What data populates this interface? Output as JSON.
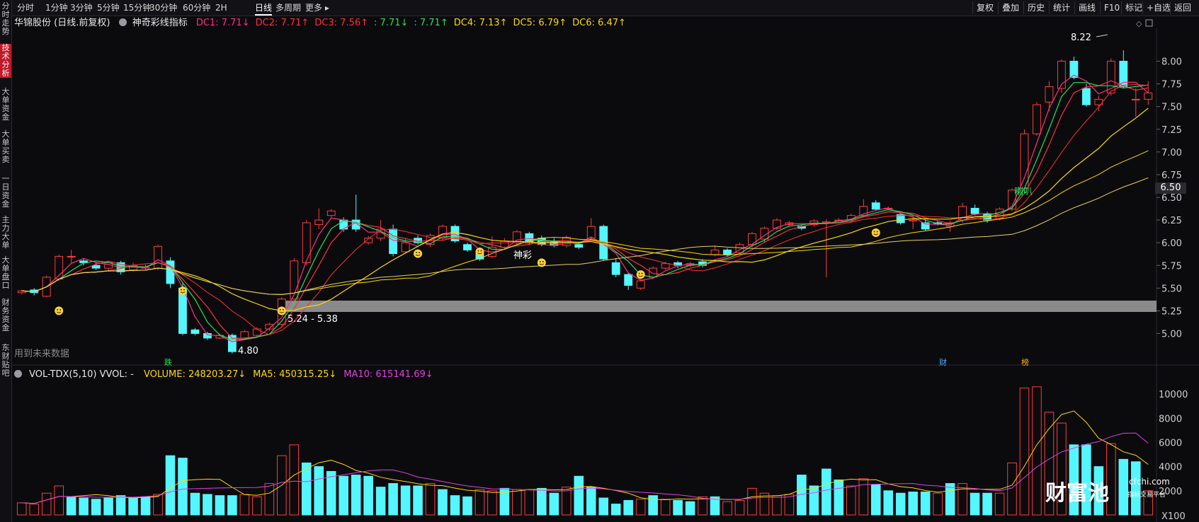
{
  "sidebar": [
    {
      "label": "分时走势",
      "active": false
    },
    {
      "label": "技术分析",
      "active": true
    },
    {
      "label": "大单资金",
      "active": false
    },
    {
      "label": "大单买卖",
      "active": false
    },
    {
      "label": "一日资金",
      "active": false
    },
    {
      "label": "主力大单",
      "active": false
    },
    {
      "label": "大单盘口",
      "active": false
    },
    {
      "label": "财务资金",
      "active": false
    },
    {
      "label": "东财贴吧",
      "active": false
    }
  ],
  "timeframes": [
    "分时",
    "1分钟",
    "3分钟",
    "5分钟",
    "15分钟",
    "30分钟",
    "60分钟",
    "2H",
    "日线",
    "多周期",
    "更多 ▸"
  ],
  "active_timeframe": "日线",
  "tools": [
    "复权",
    "叠加",
    "历史",
    "统计",
    "画线",
    "F10",
    "标记",
    "+自选",
    "返回"
  ],
  "main_header": {
    "stock": "华锦股份 (日线.前复权)",
    "indicator_icon": "gear-icon",
    "indicator": "神奇彩线指标",
    "values": [
      {
        "text": "DC1: 7.71↓",
        "color": "#ff2f7d"
      },
      {
        "text": "DC2: 7.71↑",
        "color": "#ff3040"
      },
      {
        "text": "DC3: 7.56↑",
        "color": "#ff3030"
      },
      {
        "text": ": 7.71↓",
        "color": "#22e05a"
      },
      {
        "text": ": 7.71↑",
        "color": "#22e05a"
      },
      {
        "text": "DC4: 7.13↑",
        "color": "#ffd800"
      },
      {
        "text": "DC5: 6.79↑",
        "color": "#ffd800"
      },
      {
        "text": "DC6: 6.47↑",
        "color": "#ffd800"
      }
    ]
  },
  "volume_header": {
    "icon": "gear-icon",
    "label": "VOL-TDX(5,10) VVOL: -",
    "values": [
      {
        "text": "VOLUME: 248203.27↓",
        "color": "#ffd800"
      },
      {
        "text": "MA5: 450315.25↓",
        "color": "#ffd800"
      },
      {
        "text": "MA10: 615141.69↓",
        "color": "#e040e0"
      }
    ]
  },
  "price_axis": [
    "8.00",
    "7.75",
    "7.50",
    "7.25",
    "7.00",
    "6.75",
    "6.50",
    "6.25",
    "6.00",
    "5.75",
    "5.50",
    "5.25",
    "5.00"
  ],
  "current_price": "6.50",
  "volume_axis": [
    "10000",
    "8000",
    "6000",
    "4000",
    "2000"
  ],
  "volume_unit": "X100",
  "annotations": {
    "high": "8.22",
    "low": "4.80",
    "gap_zone": "5.24 - 5.38",
    "future_data": "用到未来数据",
    "shencai": "神彩",
    "laba": "喇叭",
    "die": "跌",
    "cai": "财",
    "bang": "榜"
  },
  "watermark": {
    "main": "财富池",
    "domain": "cfchi.com",
    "tagline": "指标交易平台"
  },
  "colors": {
    "up": "#ff3b3b",
    "down": "#54f6ff",
    "bg": "#0b0b0e"
  },
  "chart_data": {
    "type": "candlestick",
    "price_range": [
      4.7,
      8.3
    ],
    "candles": [
      [
        5.45,
        5.47,
        5.43,
        5.48
      ],
      [
        5.48,
        5.45,
        5.42,
        5.5
      ],
      [
        5.41,
        5.62,
        5.4,
        5.64
      ],
      [
        5.6,
        5.85,
        5.58,
        5.87
      ],
      [
        5.85,
        5.85,
        5.78,
        5.92
      ],
      [
        5.8,
        5.78,
        5.75,
        5.82
      ],
      [
        5.75,
        5.72,
        5.7,
        5.78
      ],
      [
        5.72,
        5.78,
        5.68,
        5.8
      ],
      [
        5.78,
        5.68,
        5.65,
        5.8
      ],
      [
        5.7,
        5.75,
        5.68,
        5.78
      ],
      [
        5.72,
        5.73,
        5.7,
        5.76
      ],
      [
        5.72,
        5.96,
        5.7,
        5.98
      ],
      [
        5.8,
        5.55,
        5.5,
        5.84
      ],
      [
        5.5,
        5.0,
        4.98,
        5.55
      ],
      [
        5.04,
        5.0,
        4.98,
        5.06
      ],
      [
        5.0,
        4.95,
        4.93,
        5.02
      ],
      [
        4.95,
        4.98,
        4.94,
        5.0
      ],
      [
        4.98,
        4.8,
        4.78,
        5.0
      ],
      [
        4.95,
        5.02,
        4.93,
        5.04
      ],
      [
        4.98,
        5.05,
        4.96,
        5.07
      ],
      [
        5.05,
        5.1,
        5.03,
        5.12
      ],
      [
        5.1,
        5.38,
        5.08,
        5.4
      ],
      [
        5.38,
        5.8,
        5.35,
        5.83
      ],
      [
        5.78,
        6.22,
        5.75,
        6.25
      ],
      [
        6.2,
        6.25,
        6.15,
        6.38
      ],
      [
        6.3,
        6.35,
        6.28,
        6.37
      ],
      [
        6.25,
        6.15,
        6.12,
        6.28
      ],
      [
        6.25,
        6.15,
        6.12,
        6.53
      ],
      [
        6.0,
        6.05,
        5.98,
        6.07
      ],
      [
        6.05,
        6.15,
        6.02,
        6.25
      ],
      [
        6.15,
        5.88,
        5.85,
        6.2
      ],
      [
        5.9,
        6.0,
        5.88,
        6.05
      ],
      [
        6.05,
        6.0,
        5.98,
        6.08
      ],
      [
        5.98,
        6.08,
        5.95,
        6.1
      ],
      [
        6.05,
        6.18,
        6.03,
        6.2
      ],
      [
        6.18,
        6.02,
        6.0,
        6.2
      ],
      [
        5.98,
        5.92,
        5.9,
        6.0
      ],
      [
        5.88,
        5.82,
        5.8,
        5.9
      ],
      [
        5.85,
        5.95,
        5.83,
        6.07
      ],
      [
        5.95,
        6.02,
        5.93,
        6.05
      ],
      [
        6.0,
        6.12,
        5.98,
        6.14
      ],
      [
        6.1,
        6.0,
        5.98,
        6.12
      ],
      [
        6.05,
        5.98,
        5.96,
        6.08
      ],
      [
        6.02,
        5.97,
        5.95,
        6.05
      ],
      [
        5.97,
        6.06,
        5.95,
        6.08
      ],
      [
        5.98,
        5.95,
        5.93,
        6.0
      ],
      [
        6.05,
        6.18,
        6.03,
        6.27
      ],
      [
        6.18,
        5.82,
        5.8,
        6.2
      ],
      [
        5.78,
        5.65,
        5.62,
        5.83
      ],
      [
        5.65,
        5.53,
        5.48,
        5.67
      ],
      [
        5.5,
        5.58,
        5.48,
        5.6
      ],
      [
        5.62,
        5.72,
        5.6,
        5.74
      ],
      [
        5.72,
        5.77,
        5.7,
        5.79
      ],
      [
        5.78,
        5.75,
        5.72,
        5.8
      ],
      [
        5.75,
        5.77,
        5.73,
        5.79
      ],
      [
        5.79,
        5.75,
        5.73,
        5.82
      ],
      [
        5.87,
        5.92,
        5.85,
        5.96
      ],
      [
        5.92,
        5.87,
        5.85,
        5.94
      ],
      [
        5.89,
        5.98,
        5.87,
        6.0
      ],
      [
        5.98,
        6.1,
        5.95,
        6.12
      ],
      [
        6.04,
        6.16,
        6.0,
        6.18
      ],
      [
        6.16,
        6.25,
        6.14,
        6.27
      ],
      [
        6.2,
        6.22,
        6.18,
        6.24
      ],
      [
        6.18,
        6.16,
        6.14,
        6.2
      ],
      [
        6.2,
        6.24,
        6.18,
        6.26
      ],
      [
        6.22,
        6.23,
        5.62,
        6.26
      ],
      [
        6.24,
        6.25,
        6.23,
        6.27
      ],
      [
        6.25,
        6.3,
        6.23,
        6.32
      ],
      [
        6.3,
        6.4,
        6.28,
        6.48
      ],
      [
        6.44,
        6.37,
        6.35,
        6.47
      ],
      [
        6.38,
        6.38,
        6.36,
        6.4
      ],
      [
        6.31,
        6.22,
        6.2,
        6.33
      ],
      [
        6.24,
        6.25,
        6.15,
        6.3
      ],
      [
        6.22,
        6.15,
        6.13,
        6.25
      ],
      [
        6.22,
        6.21,
        6.19,
        6.24
      ],
      [
        6.18,
        6.22,
        6.12,
        6.24
      ],
      [
        6.25,
        6.4,
        6.22,
        6.44
      ],
      [
        6.38,
        6.32,
        6.3,
        6.42
      ],
      [
        6.32,
        6.25,
        6.22,
        6.34
      ],
      [
        6.27,
        6.37,
        6.25,
        6.39
      ],
      [
        6.37,
        6.58,
        6.35,
        6.6
      ],
      [
        6.6,
        7.2,
        6.58,
        7.25
      ],
      [
        7.2,
        7.52,
        7.18,
        7.55
      ],
      [
        7.55,
        7.72,
        7.45,
        7.78
      ],
      [
        7.7,
        8.0,
        7.65,
        8.02
      ],
      [
        8.0,
        7.82,
        7.8,
        8.05
      ],
      [
        7.7,
        7.52,
        7.5,
        7.75
      ],
      [
        7.52,
        7.58,
        7.45,
        7.62
      ],
      [
        7.65,
        8.0,
        7.62,
        8.03
      ],
      [
        8.0,
        7.72,
        7.7,
        8.12
      ],
      [
        7.58,
        7.58,
        7.39,
        7.7
      ],
      [
        7.58,
        7.65,
        7.52,
        7.78
      ]
    ],
    "volume_range": [
      0,
      11000
    ],
    "volume": [
      [
        1000,
        true
      ],
      [
        900,
        true
      ],
      [
        1800,
        true
      ],
      [
        2400,
        true
      ],
      [
        1500,
        false
      ],
      [
        1400,
        false
      ],
      [
        1300,
        false
      ],
      [
        1400,
        false
      ],
      [
        1600,
        false
      ],
      [
        1400,
        false
      ],
      [
        1500,
        false
      ],
      [
        1700,
        true
      ],
      [
        4900,
        false
      ],
      [
        4700,
        false
      ],
      [
        1800,
        false
      ],
      [
        1700,
        false
      ],
      [
        1600,
        false
      ],
      [
        1600,
        false
      ],
      [
        1700,
        true
      ],
      [
        1500,
        true
      ],
      [
        2600,
        true
      ],
      [
        4900,
        true
      ],
      [
        5800,
        true
      ],
      [
        4300,
        false
      ],
      [
        4000,
        false
      ],
      [
        3600,
        false
      ],
      [
        3200,
        false
      ],
      [
        3300,
        false
      ],
      [
        3200,
        false
      ],
      [
        2300,
        false
      ],
      [
        2600,
        false
      ],
      [
        2400,
        false
      ],
      [
        2400,
        false
      ],
      [
        2600,
        true
      ],
      [
        2100,
        false
      ],
      [
        1600,
        false
      ],
      [
        1500,
        false
      ],
      [
        2100,
        true
      ],
      [
        2000,
        true
      ],
      [
        2200,
        false
      ],
      [
        2100,
        true
      ],
      [
        2100,
        true
      ],
      [
        2200,
        false
      ],
      [
        1800,
        false
      ],
      [
        2300,
        true
      ],
      [
        3200,
        false
      ],
      [
        2300,
        false
      ],
      [
        1400,
        false
      ],
      [
        900,
        false
      ],
      [
        1200,
        false
      ],
      [
        1300,
        true
      ],
      [
        1600,
        false
      ],
      [
        1300,
        true
      ],
      [
        1200,
        false
      ],
      [
        1100,
        false
      ],
      [
        1500,
        true
      ],
      [
        1500,
        false
      ],
      [
        1100,
        true
      ],
      [
        1200,
        true
      ],
      [
        2200,
        true
      ],
      [
        1800,
        true
      ],
      [
        1600,
        true
      ],
      [
        1700,
        true
      ],
      [
        3300,
        false
      ],
      [
        2400,
        false
      ],
      [
        3800,
        false
      ],
      [
        2900,
        false
      ],
      [
        2400,
        true
      ],
      [
        3000,
        true
      ],
      [
        2500,
        false
      ],
      [
        2000,
        false
      ],
      [
        1800,
        false
      ],
      [
        1900,
        false
      ],
      [
        1900,
        false
      ],
      [
        1800,
        true
      ],
      [
        2600,
        false
      ],
      [
        2600,
        true
      ],
      [
        1800,
        false
      ],
      [
        1800,
        false
      ],
      [
        1800,
        true
      ],
      [
        4300,
        true
      ],
      [
        10500,
        true
      ],
      [
        10600,
        true
      ],
      [
        8500,
        true
      ],
      [
        7600,
        true
      ],
      [
        5800,
        false
      ],
      [
        5800,
        false
      ],
      [
        4000,
        false
      ],
      [
        5900,
        true
      ],
      [
        4600,
        false
      ],
      [
        4400,
        false
      ],
      [
        2000,
        true
      ]
    ]
  }
}
